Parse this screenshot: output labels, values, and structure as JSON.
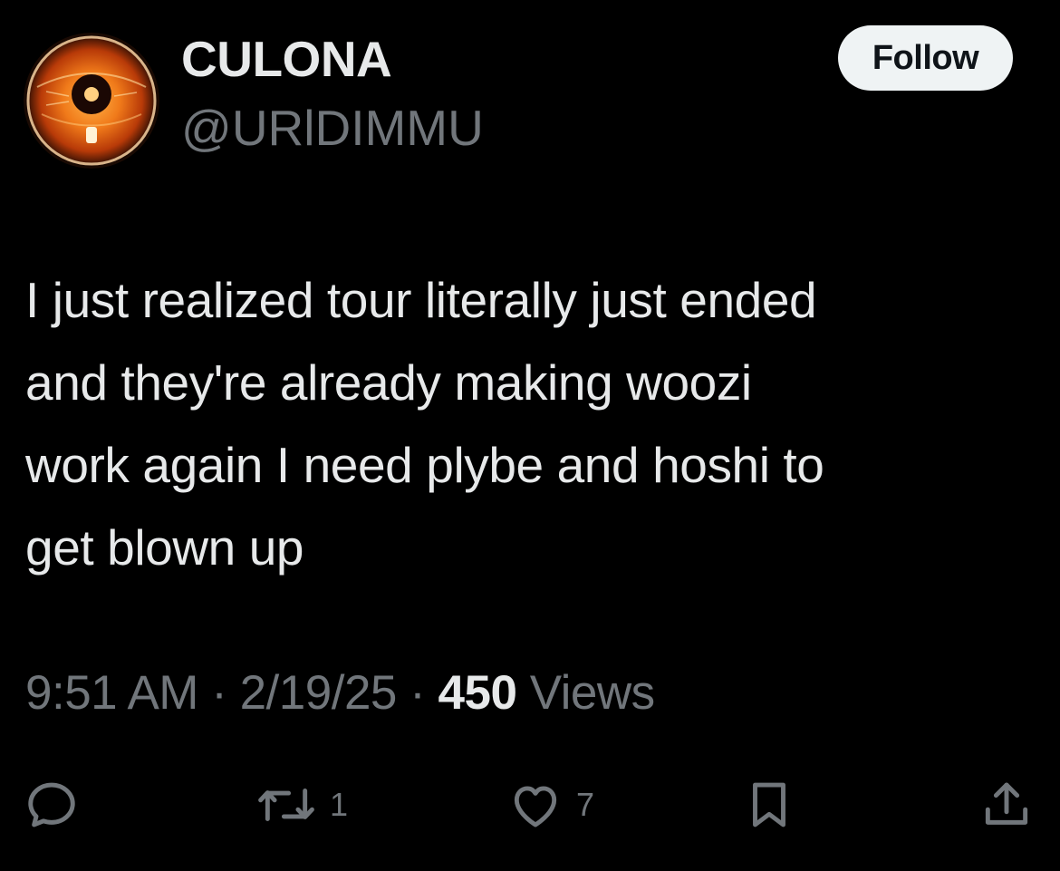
{
  "user": {
    "display_name": "CULONA",
    "handle": "@URlDIMMU",
    "avatar_icon": "orange-eye-avatar"
  },
  "follow_button": {
    "label": "Follow"
  },
  "tweet": {
    "lines": [
      "I just realized tour literally just ended",
      "and they're already making woozi",
      "work again I need plybe and hoshi to",
      "get blown up"
    ]
  },
  "meta": {
    "time": "9:51 AM",
    "separator": "·",
    "date": "2/19/25",
    "views_count": "450",
    "views_label": "Views"
  },
  "actions": {
    "reply": {
      "icon": "reply-icon"
    },
    "retweet": {
      "icon": "retweet-icon",
      "count": "1"
    },
    "like": {
      "icon": "heart-icon",
      "count": "7"
    },
    "bookmark": {
      "icon": "bookmark-icon"
    },
    "share": {
      "icon": "share-icon"
    }
  },
  "colors": {
    "background": "#000000",
    "primary_text": "#e7e9ea",
    "secondary_text": "#71767b",
    "button_bg": "#eff3f4",
    "button_text": "#0f1419"
  }
}
